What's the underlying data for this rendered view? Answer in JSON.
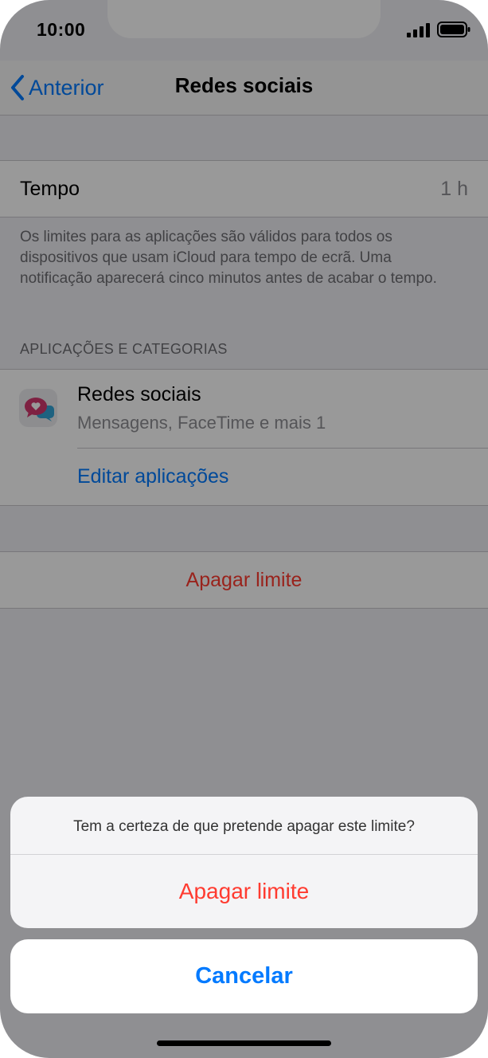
{
  "status_bar": {
    "time": "10:00"
  },
  "nav": {
    "back_label": "Anterior",
    "title": "Redes sociais"
  },
  "tempo_row": {
    "label": "Tempo",
    "value": "1 h"
  },
  "footnote": "Os limites para as aplicações são válidos para todos os dispositivos que usam iCloud para tempo de ecrã. Uma notificação aparecerá cinco minutos antes de acabar o tempo.",
  "apps_section": {
    "header": "APLICAÇÕES E CATEGORIAS",
    "item_title": "Redes sociais",
    "item_subtitle": "Mensagens, FaceTime e mais 1",
    "edit_link": "Editar aplicações"
  },
  "delete_row": {
    "label": "Apagar limite"
  },
  "action_sheet": {
    "message": "Tem a certeza de que pretende apagar este limite?",
    "destructive_label": "Apagar limite",
    "cancel_label": "Cancelar"
  },
  "colors": {
    "accent": "#007aff",
    "destructive": "#ff3b30",
    "background": "#efeff4"
  },
  "icons": {
    "back": "chevron-left-icon",
    "app": "social-bubbles-icon",
    "signal": "cellular-signal-icon",
    "battery": "battery-icon"
  }
}
